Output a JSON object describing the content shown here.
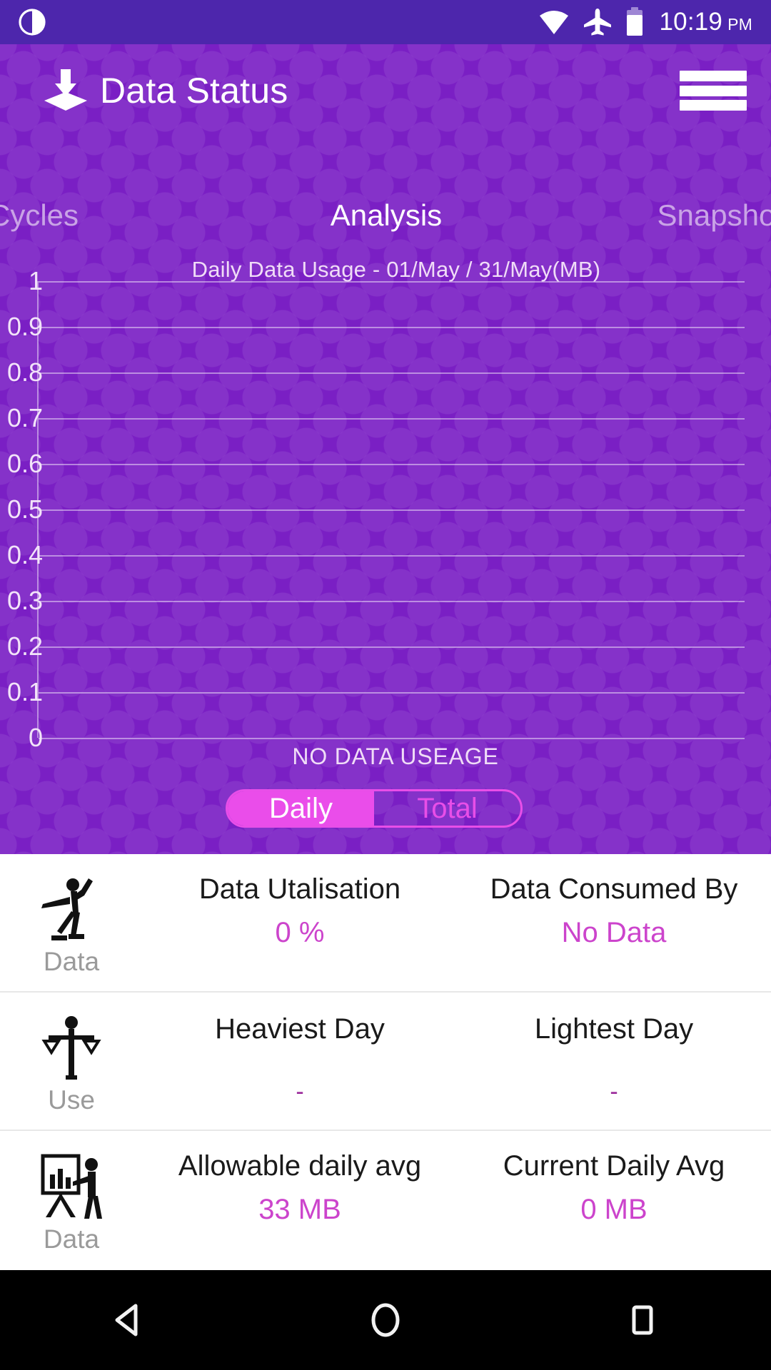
{
  "status_bar": {
    "left_icon": "crescent-moon-icon",
    "wifi_icon": "wifi-icon",
    "airplane_icon": "airplane-mode-icon",
    "battery_icon": "battery-icon",
    "time": "10:19",
    "ampm": "PM",
    "background_color": "#4d26ac"
  },
  "app_bar": {
    "icon": "download-to-tray-icon",
    "title": "Data Status",
    "menu_icon": "hamburger-menu-icon"
  },
  "tabs": [
    {
      "label": "Cycles",
      "active": false
    },
    {
      "label": "Analysis",
      "active": true
    },
    {
      "label": "Snapshot",
      "active": false
    }
  ],
  "chart_data": {
    "type": "bar",
    "title": "Daily Data Usage - 01/May / 31/May(MB)",
    "xlabel": "",
    "ylabel": "",
    "categories": [],
    "values": [],
    "ylim": [
      0,
      1
    ],
    "yticks": [
      "1",
      "0.9",
      "0.8",
      "0.7",
      "0.6",
      "0.5",
      "0.4",
      "0.3",
      "0.2",
      "0.1",
      "0"
    ],
    "grid": true,
    "legend": "none",
    "empty_message": "NO DATA USEAGE"
  },
  "toggle": {
    "options": [
      {
        "label": "Daily",
        "selected": true
      },
      {
        "label": "Total",
        "selected": false
      }
    ],
    "accent_color": "#e84ee8"
  },
  "stat_rows": [
    {
      "icon": "person-throwing-icon",
      "icon_label": "Data",
      "cells": [
        {
          "title": "Data Utalisation",
          "value": "0 %"
        },
        {
          "title": "Data Consumed By",
          "value": "No Data"
        }
      ]
    },
    {
      "icon": "person-scales-icon",
      "icon_label": "Use",
      "cells": [
        {
          "title": "Heaviest Day",
          "value": "-"
        },
        {
          "title": "Lightest Day",
          "value": "-"
        }
      ]
    },
    {
      "icon": "presentation-board-icon",
      "icon_label": "Data",
      "cells": [
        {
          "title": "Allowable daily avg",
          "value": "33 MB"
        },
        {
          "title": "Current Daily Avg",
          "value": "0 MB"
        }
      ]
    }
  ],
  "nav_bar": {
    "back": "back-triangle-icon",
    "home": "home-circle-icon",
    "recents": "recents-square-icon"
  },
  "theme": {
    "purple_bg": "#7a1fc4",
    "status_bar_purple": "#4d26ac",
    "magenta": "#cc44cc",
    "toggle_fill": "#ea4dea"
  }
}
